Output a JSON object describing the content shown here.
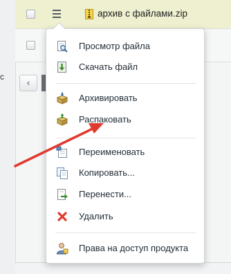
{
  "file_row": {
    "name": "архив с файлами.zip"
  },
  "left_stub_text": "с",
  "pager": {
    "prev_glyph": "‹"
  },
  "context_menu": {
    "groups": [
      [
        {
          "label": "Просмотр файла",
          "icon": "view-file-icon"
        },
        {
          "label": "Скачать файл",
          "icon": "download-icon"
        }
      ],
      [
        {
          "label": "Архивировать",
          "icon": "archive-icon"
        },
        {
          "label": "Распаковать",
          "icon": "unpack-icon"
        }
      ],
      [
        {
          "label": "Переименовать",
          "icon": "rename-icon"
        },
        {
          "label": "Копировать...",
          "icon": "copy-icon"
        },
        {
          "label": "Перенести...",
          "icon": "move-icon"
        },
        {
          "label": "Удалить",
          "icon": "delete-icon"
        }
      ],
      [
        {
          "label": "Права на доступ продукта",
          "icon": "access-rights-icon"
        }
      ]
    ]
  },
  "colors": {
    "selected_row": "#eef0cf",
    "arrow": "#e03a2f",
    "delete_icon": "#e03b2c"
  }
}
